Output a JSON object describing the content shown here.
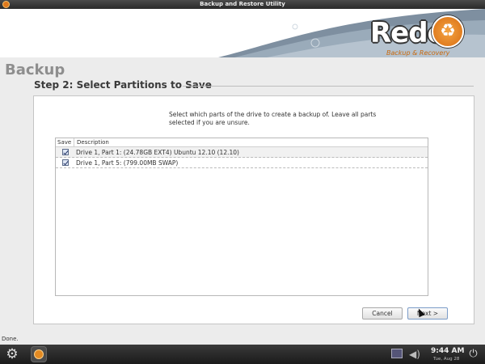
{
  "window": {
    "title": "Backup and Restore Utility"
  },
  "banner": {
    "logo_text": "Redo",
    "logo_tagline": "Backup & Recovery",
    "logo_badge_icon": "recycle-icon"
  },
  "page": {
    "section_title": "Backup",
    "step_title": "Step 2: Select Partitions to Save",
    "instructions": "Select which parts of the drive to create a backup of.  Leave all parts selected if you are unsure."
  },
  "table": {
    "headers": {
      "save": "Save",
      "description": "Description"
    },
    "rows": [
      {
        "checked": true,
        "description": "Drive 1, Part 1: (24.78GB EXT4) Ubuntu 12.10 (12.10)"
      },
      {
        "checked": true,
        "description": "Drive 1, Part 5: (799.00MB SWAP)"
      }
    ]
  },
  "buttons": {
    "cancel": "Cancel",
    "next": "Next >"
  },
  "status": {
    "text": "Done."
  },
  "taskbar": {
    "time": "9:44 AM",
    "date": "Tue, Aug 28",
    "icons": [
      "gear-icon",
      "redo-app-icon",
      "network-icon",
      "volume-icon",
      "power-icon"
    ]
  },
  "colors": {
    "accent": "#e07a1e",
    "section_title": "#8e8e8e"
  }
}
